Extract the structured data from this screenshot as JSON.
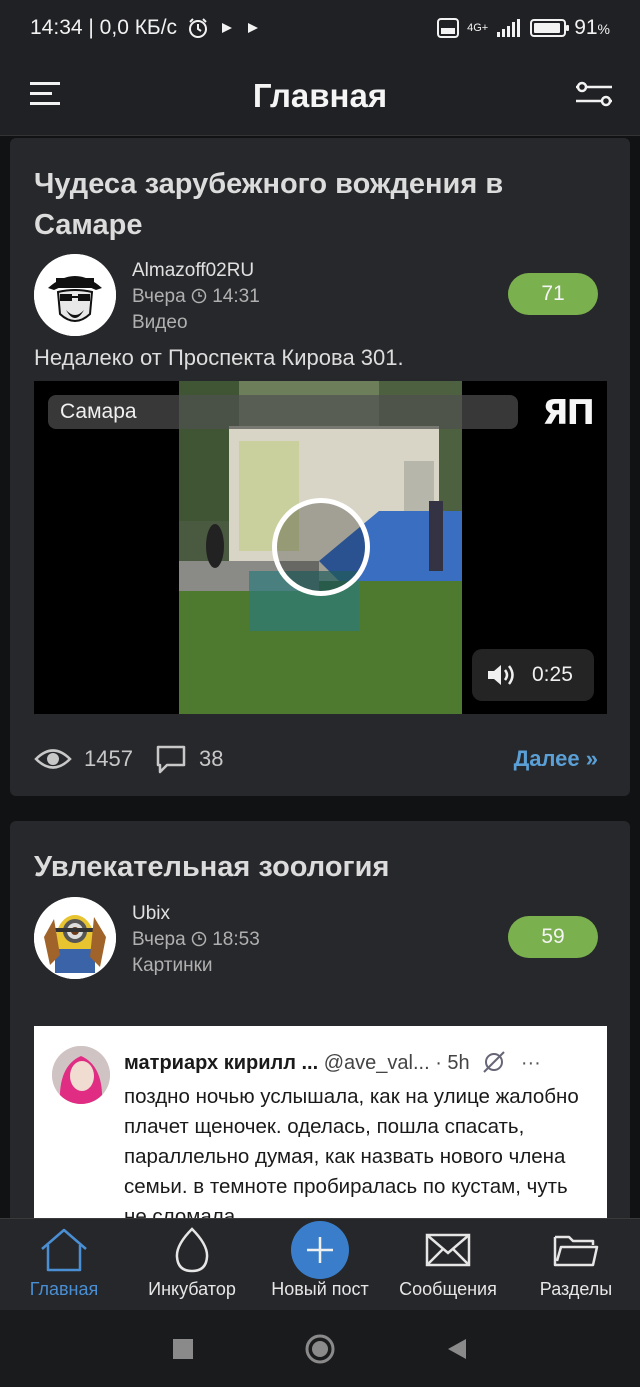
{
  "status_bar": {
    "time_and_speed": "14:34 | 0,0 КБ/с",
    "network": "4G+",
    "battery_percent": "91",
    "battery_suffix": "%",
    "battery_level": 0.91
  },
  "header": {
    "title": "Главная"
  },
  "posts": [
    {
      "title": "Чудеса зарубежного вождения в Самаре",
      "author": "Almazoff02RU",
      "date": "Вчера",
      "time": "14:31",
      "category": "Видео",
      "rating": "71",
      "text": "Недалеко от Проспекта Кирова 301.",
      "video": {
        "label": "Самара",
        "logo": "ЯП",
        "duration": "0:25"
      },
      "views": "1457",
      "comments": "38",
      "more_link": "Далее »"
    },
    {
      "title": "Увлекательная зоология",
      "author": "Ubix",
      "date": "Вчера",
      "time": "18:53",
      "category": "Картинки",
      "rating": "59",
      "tweet": {
        "name": "матриарх кирилл ...",
        "handle": "@ave_val...",
        "age": "· 5h",
        "more": "···",
        "text": "поздно ночью услышала, как на улице жалобно плачет щеночек. оделась, пошла спасать, параллельно думая, как назвать нового члена семьи. в темноте пробиралась по кустам, чуть не сломала"
      }
    }
  ],
  "bottom_nav": [
    {
      "label": "Главная",
      "icon": "home-icon",
      "active": true
    },
    {
      "label": "Инкубатор",
      "icon": "egg-icon",
      "active": false
    },
    {
      "label": "Новый пост",
      "icon": "plus-icon",
      "active": false
    },
    {
      "label": "Сообщения",
      "icon": "envelope-icon",
      "active": false
    },
    {
      "label": "Разделы",
      "icon": "folder-icon",
      "active": false
    }
  ],
  "colors": {
    "accent": "#4a8fd4",
    "rating_bg": "#7ab04d",
    "card_bg": "#27282b",
    "link": "#5a9fd6"
  }
}
